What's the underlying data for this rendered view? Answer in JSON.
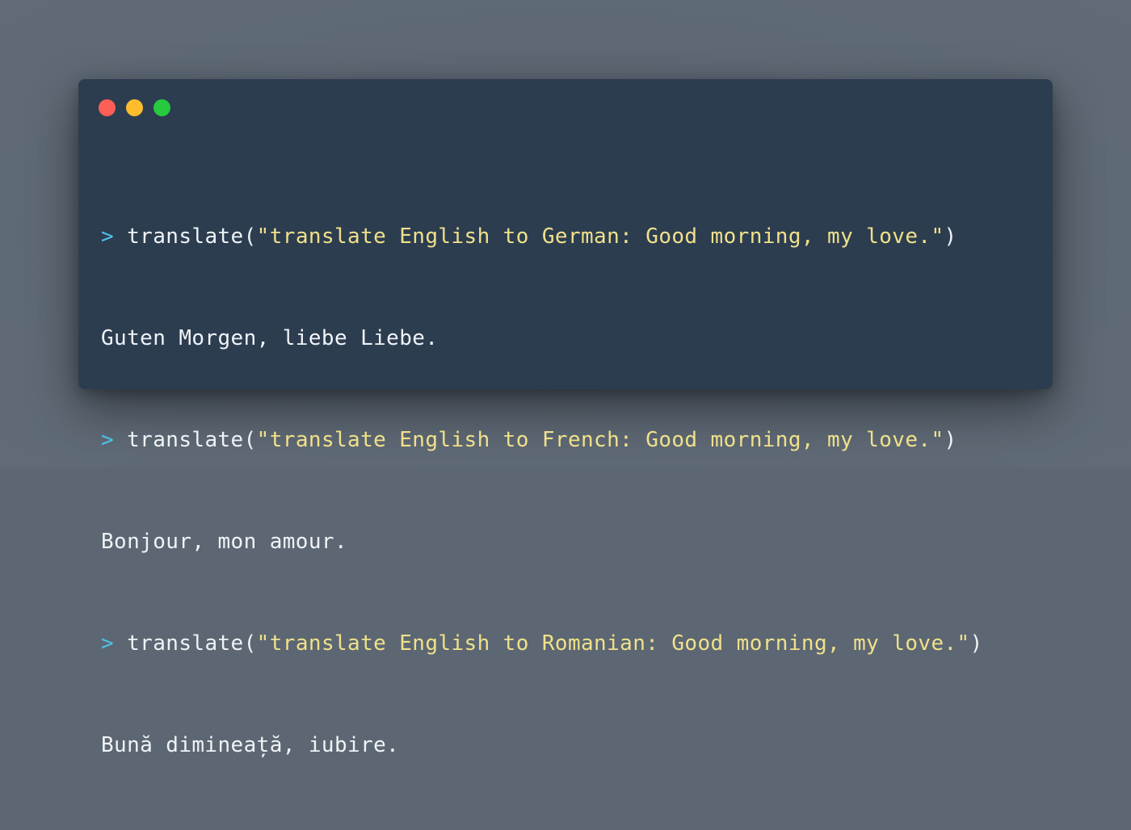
{
  "window": {
    "controls": [
      {
        "name": "close",
        "color": "#ff5f56"
      },
      {
        "name": "minimize",
        "color": "#ffbd2e"
      },
      {
        "name": "maximize",
        "color": "#27c93f"
      }
    ]
  },
  "colors": {
    "background": "#5c6773",
    "window": "#2c3d50",
    "prompt": "#4fc1e9",
    "string": "#f0e08a",
    "text": "#f0f3f6"
  },
  "console": {
    "lines": [
      {
        "prompt": ">",
        "fn": "translate(",
        "str": "\"translate English to German: Good morning, my love.\"",
        "close": ")"
      },
      {
        "output": "Guten Morgen, liebe Liebe."
      },
      {
        "prompt": ">",
        "fn": "translate(",
        "str": "\"translate English to French: Good morning, my love.\"",
        "close": ")"
      },
      {
        "output": "Bonjour, mon amour."
      },
      {
        "prompt": ">",
        "fn": "translate(",
        "str": "\"translate English to Romanian: Good morning, my love.\"",
        "close": ")"
      },
      {
        "output": "Bună dimineață, iubire."
      }
    ]
  }
}
